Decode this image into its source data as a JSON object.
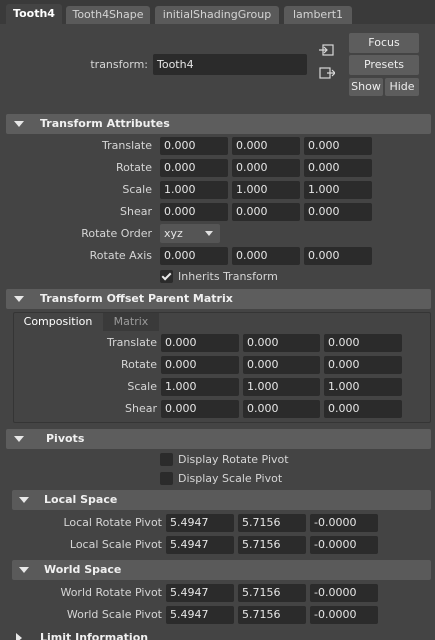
{
  "tabs": [
    "Tooth4",
    "Tooth4Shape",
    "initialShadingGroup",
    "lambert1"
  ],
  "transform": {
    "label": "transform:",
    "value": "Tooth4"
  },
  "buttons": {
    "focus": "Focus",
    "presets": "Presets",
    "show": "Show",
    "hide": "Hide"
  },
  "icons": {
    "select_in": "input-connection-icon",
    "select_out": "output-connection-icon"
  },
  "transform_attributes": {
    "title": "Transform Attributes",
    "translate": {
      "label": "Translate",
      "values": [
        "0.000",
        "0.000",
        "0.000"
      ]
    },
    "rotate": {
      "label": "Rotate",
      "values": [
        "0.000",
        "0.000",
        "0.000"
      ]
    },
    "scale": {
      "label": "Scale",
      "values": [
        "1.000",
        "1.000",
        "1.000"
      ]
    },
    "shear": {
      "label": "Shear",
      "values": [
        "0.000",
        "0.000",
        "0.000"
      ]
    },
    "rotate_order": {
      "label": "Rotate Order",
      "value": "xyz"
    },
    "rotate_axis": {
      "label": "Rotate Axis",
      "values": [
        "0.000",
        "0.000",
        "0.000"
      ]
    },
    "inherits": {
      "label": "Inherits Transform",
      "checked": true
    }
  },
  "offset_parent": {
    "title": "Transform Offset Parent Matrix",
    "tabs": [
      "Composition",
      "Matrix"
    ],
    "translate": {
      "label": "Translate",
      "values": [
        "0.000",
        "0.000",
        "0.000"
      ]
    },
    "rotate": {
      "label": "Rotate",
      "values": [
        "0.000",
        "0.000",
        "0.000"
      ]
    },
    "scale": {
      "label": "Scale",
      "values": [
        "1.000",
        "1.000",
        "1.000"
      ]
    },
    "shear": {
      "label": "Shear",
      "values": [
        "0.000",
        "0.000",
        "0.000"
      ]
    }
  },
  "pivots": {
    "title": "Pivots",
    "display_rotate": {
      "label": "Display Rotate Pivot",
      "checked": false
    },
    "display_scale": {
      "label": "Display Scale Pivot",
      "checked": false
    },
    "local_space": {
      "title": "Local Space",
      "rotate_pivot": {
        "label": "Local Rotate Pivot",
        "values": [
          "5.4947",
          "5.7156",
          "-0.0000"
        ]
      },
      "scale_pivot": {
        "label": "Local Scale Pivot",
        "values": [
          "5.4947",
          "5.7156",
          "-0.0000"
        ]
      }
    },
    "world_space": {
      "title": "World Space",
      "rotate_pivot": {
        "label": "World Rotate Pivot",
        "values": [
          "5.4947",
          "5.7156",
          "-0.0000"
        ]
      },
      "scale_pivot": {
        "label": "World Scale Pivot",
        "values": [
          "5.4947",
          "5.7156",
          "-0.0000"
        ]
      }
    }
  },
  "limit_info": {
    "title": "Limit Information"
  }
}
